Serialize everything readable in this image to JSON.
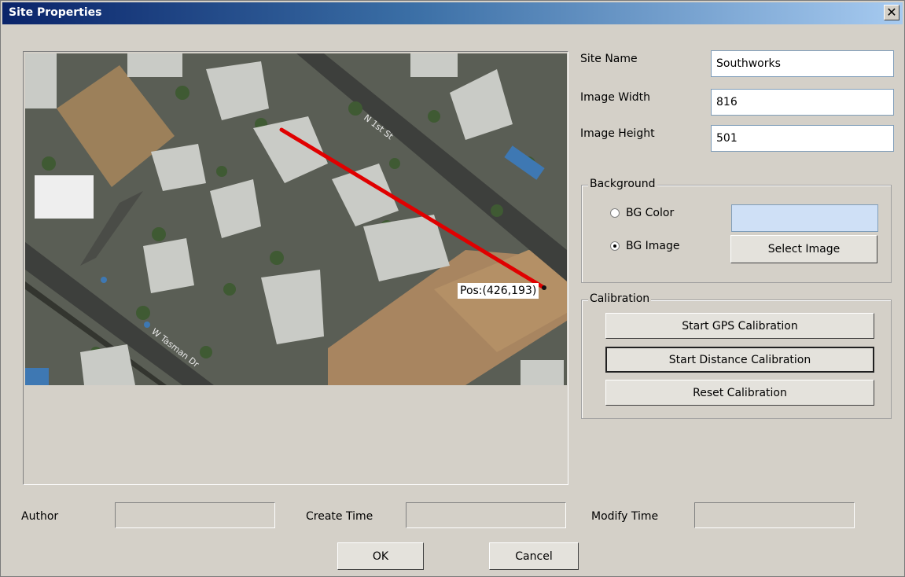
{
  "window": {
    "title": "Site Properties",
    "close_glyph": "✕"
  },
  "map": {
    "position_readout": "Pos:(426,193)",
    "street_labels": [
      "N 1st St",
      "W Tasman Dr"
    ]
  },
  "fields": {
    "site_name": {
      "label": "Site Name",
      "value": "Southworks"
    },
    "image_width": {
      "label": "Image Width",
      "value": "816"
    },
    "image_height": {
      "label": "Image Height",
      "value": "501"
    }
  },
  "background": {
    "title": "Background",
    "bg_color_label": "BG Color",
    "bg_image_label": "BG Image",
    "selected": "BG Image",
    "color_value": "#cfe0f6",
    "select_image_button": "Select Image"
  },
  "calibration": {
    "title": "Calibration",
    "gps_button": "Start GPS Calibration",
    "distance_button": "Start Distance Calibration",
    "reset_button": "Reset Calibration"
  },
  "footer": {
    "author_label": "Author",
    "author_value": "",
    "create_time_label": "Create Time",
    "create_time_value": "",
    "modify_time_label": "Modify Time",
    "modify_time_value": "",
    "ok_button": "OK",
    "cancel_button": "Cancel"
  },
  "colors": {
    "title_gradient_start": "#0a246a",
    "dialog_background": "#d4d0c8",
    "measure_line": "#e00000"
  }
}
